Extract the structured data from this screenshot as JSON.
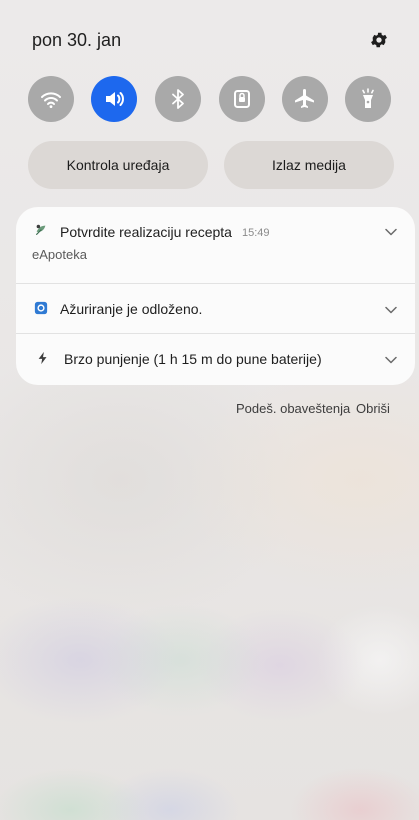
{
  "status": {
    "date": "pon 30. jan",
    "settings_icon": "gear-icon"
  },
  "quick_settings": [
    {
      "name": "wifi",
      "icon": "wifi-icon",
      "active": false
    },
    {
      "name": "sound",
      "icon": "sound-icon",
      "active": true
    },
    {
      "name": "bluetooth",
      "icon": "bluetooth-icon",
      "active": false
    },
    {
      "name": "screen-lock",
      "icon": "lock-icon",
      "active": false
    },
    {
      "name": "airplane-mode",
      "icon": "airplane-icon",
      "active": false
    },
    {
      "name": "flashlight",
      "icon": "flashlight-icon",
      "active": false
    }
  ],
  "buttons": {
    "device_control": "Kontrola uređaja",
    "media_output": "Izlaz medija"
  },
  "notifications": [
    {
      "title": "Potvrdite realizaciju recepta",
      "time": "15:49",
      "app": "eApoteka",
      "icon": "eapoteka-app-icon"
    },
    {
      "title": "Ažuriranje je odloženo.",
      "icon": "update-app-icon"
    },
    {
      "title": "Brzo punjenje (1 h 15 m do pune baterije)",
      "icon": "charging-icon"
    }
  ],
  "footer": {
    "settings": "Podeš. obaveštenja",
    "clear": "Obriši"
  },
  "colors": {
    "active_tile": "#1d68ee",
    "inactive_tile": "#a9a9a9"
  }
}
